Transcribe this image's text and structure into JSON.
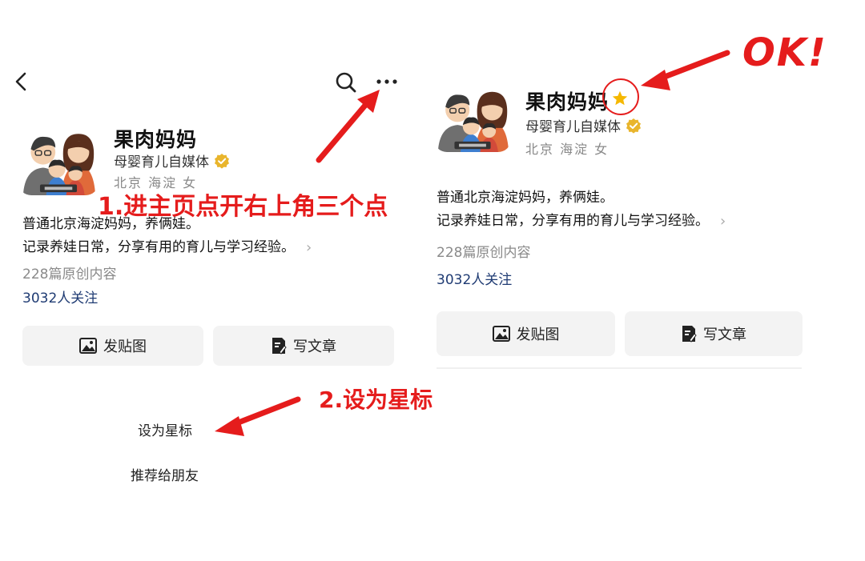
{
  "left_screen": {
    "profile": {
      "name": "果肉妈妈",
      "category": "母婴育儿自媒体",
      "location": "北京 海淀 女",
      "bio_line1": "普通北京海淀妈妈，养俩娃。",
      "bio_line2": "记录养娃日常，分享有用的育儿与学习经验。",
      "original_count": "228篇原创内容",
      "followers": "3032人关注"
    },
    "buttons": {
      "post_image": "发贴图",
      "write_article": "写文章"
    },
    "menu": {
      "set_star": "设为星标",
      "recommend": "推荐给朋友"
    }
  },
  "right_screen": {
    "profile": {
      "name": "果肉妈妈",
      "category": "母婴育儿自媒体",
      "location": "北京 海淀 女",
      "bio_line1": "普通北京海淀妈妈，养俩娃。",
      "bio_line2": "记录养娃日常，分享有用的育儿与学习经验。",
      "original_count": "228篇原创内容",
      "followers": "3032人关注"
    },
    "buttons": {
      "post_image": "发贴图",
      "write_article": "写文章"
    }
  },
  "annotations": {
    "step1": "1.进主页点开右上角三个点",
    "step2": "2.设为星标",
    "ok": "OK!"
  },
  "colors": {
    "annotation_red": "#e51c1c",
    "star_gold": "#f5b800",
    "verify_gold": "#e9b52c",
    "link_blue": "#1f3b73"
  },
  "icons": [
    "back-icon",
    "search-icon",
    "more-icon",
    "verified-icon",
    "star-icon",
    "image-icon",
    "article-icon",
    "chevron-right-icon"
  ]
}
